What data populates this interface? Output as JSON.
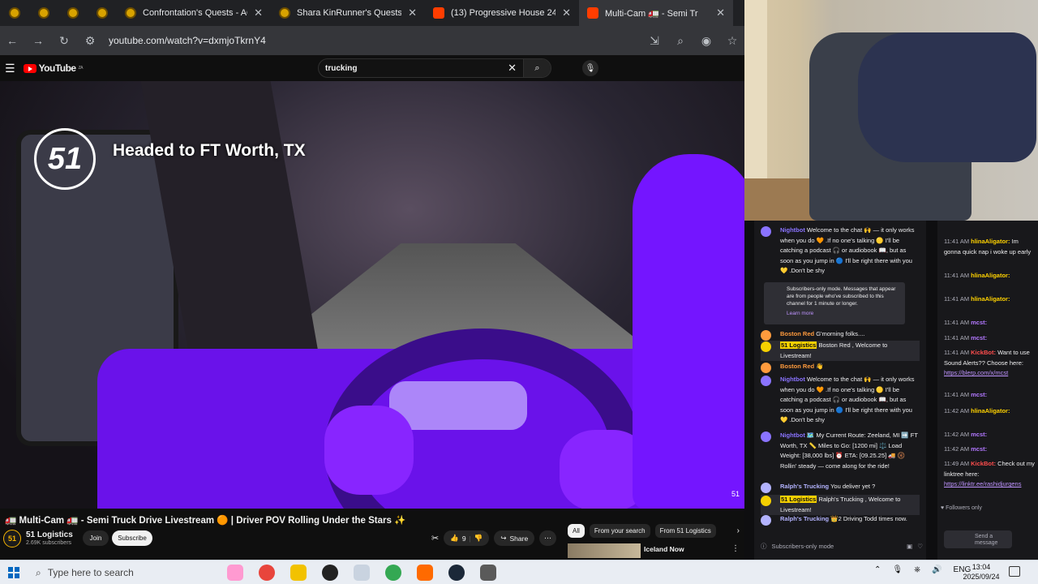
{
  "browser": {
    "tabs": [
      {
        "title": "Confrontation's Quests - AQW"
      },
      {
        "title": "Shara KinRunner's Quests - AQW"
      },
      {
        "title": "(13) Progressive House 24/7: M"
      },
      {
        "title": "Multi-Cam 🚛 - Semi Tr"
      }
    ],
    "url": "youtube.com/watch?v=dxmjoTkrnY4"
  },
  "youtube": {
    "logo_text": "YouTube",
    "logo_region": "ZA",
    "search_value": "trucking",
    "video": {
      "overlay_text": "Headed to FT Worth, TX",
      "badge_text": "51",
      "watermark": "51",
      "title": "🚛 Multi-Cam 🚛 - Semi Truck Drive Livestream 🟠 | Driver POV Rolling Under the Stars ✨"
    },
    "channel": {
      "avatar": "51",
      "name": "51 Logistics",
      "subs": "2.69K subscribers",
      "join": "Join",
      "subscribe": "Subscribe"
    },
    "likes": "9",
    "share": "Share",
    "chips": [
      "All",
      "From your search",
      "From 51 Logistics"
    ],
    "rec_title": "Iceland Now"
  },
  "chat_a": {
    "messages": [
      {
        "name": "Nightbot",
        "text": "Welcome to the chat 🙌 — it only works when you do 🧡 .If no one's talking 🟡 I'll be catching a podcast 🎧 or audiobook 📖, but as soon as you jump in 🔵 I'll be right there with you 💛 .Don't be shy",
        "color": "#8a73ff"
      },
      {
        "name": "Boston Red",
        "text": "G'morning folks....",
        "color": "#ff9b3d"
      },
      {
        "name": "51 Logistics",
        "text": "Boston Red , Welcome to Livestream!",
        "color": "#f5d000"
      },
      {
        "name": "Boston Red",
        "text": "👋",
        "color": "#ff9b3d"
      },
      {
        "name": "Nightbot",
        "text": "Welcome to the chat 🙌 — it only works when you do 🧡 .If no one's talking 🟡 I'll be catching a podcast 🎧 or audiobook 📖, but as soon as you jump in 🔵 I'll be right there with you 💛 .Don't be shy",
        "color": "#8a73ff"
      },
      {
        "name": "Nightbot",
        "text": "🗺️ My Current Route: Zeeland, MI ➡️ FT Worth, TX 📏 Miles to Go: [1200 mi] ⚖️ Load Weight: [38,000 lbs] ⏰ ETA: [09.25.25] 🚚 🛞 Rollin' steady — come along for the ride!",
        "color": "#8a73ff"
      },
      {
        "name": "Ralph's Trucking",
        "text": "You deliver yet ?",
        "color": "#b3b3ff"
      },
      {
        "name": "51 Logistics",
        "text": "Ralph's Trucking , Welcome to Livestream!",
        "color": "#f5d000"
      },
      {
        "name": "Ralph's Trucking",
        "text": "👑2 Driving Todd times now.",
        "color": "#b3b3ff"
      }
    ],
    "notice": "Subscribers-only mode. Messages that appear are from people who've subscribed to this channel for 1 minute or longer.",
    "notice_link": "Learn more",
    "mode": "Subscribers-only mode"
  },
  "chat_b": {
    "messages": [
      {
        "time": "11:41 AM",
        "name": "hlinaAligator:",
        "text": "Im gonna quick nap i woke up early",
        "color": "#ffd200"
      },
      {
        "time": "11:41 AM",
        "name": "hlinaAligator:",
        "text": "",
        "color": "#ffd200"
      },
      {
        "time": "11:41 AM",
        "name": "hlinaAligator:",
        "text": "",
        "color": "#ffd200"
      },
      {
        "time": "11:41 AM",
        "name": "mcst:",
        "text": "",
        "color": "#b277ff"
      },
      {
        "time": "11:41 AM",
        "name": "mcst:",
        "text": "",
        "color": "#b277ff"
      },
      {
        "time": "11:41 AM",
        "name": "KickBot:",
        "text": "Want to use Sound Alerts?? Choose here:",
        "link": "https://blerp.com/x/mcst",
        "color": "#ff4d4d"
      },
      {
        "time": "11:41 AM",
        "name": "mcst:",
        "text": "",
        "color": "#b277ff"
      },
      {
        "time": "11:42 AM",
        "name": "hlinaAligator:",
        "text": "",
        "color": "#ffd200"
      },
      {
        "time": "11:42 AM",
        "name": "mcst:",
        "text": "",
        "color": "#b277ff"
      },
      {
        "time": "11:42 AM",
        "name": "mcst:",
        "text": "",
        "color": "#b277ff"
      },
      {
        "time": "11:49 AM",
        "name": "KickBot:",
        "text": "Check out my linktree here:",
        "link": "https://linktr.ee/rashidjurgens",
        "color": "#ff4d4d"
      }
    ],
    "followers": "Followers only",
    "send": "Send a message"
  },
  "taskbar": {
    "search_placeholder": "Type here to search",
    "lang": "ENG",
    "time": "13:04",
    "date": "2025/09/24"
  },
  "colors": {
    "accent": "#ff0000",
    "twitch": "#bf94ff",
    "video_tint": "#6a12ea"
  }
}
